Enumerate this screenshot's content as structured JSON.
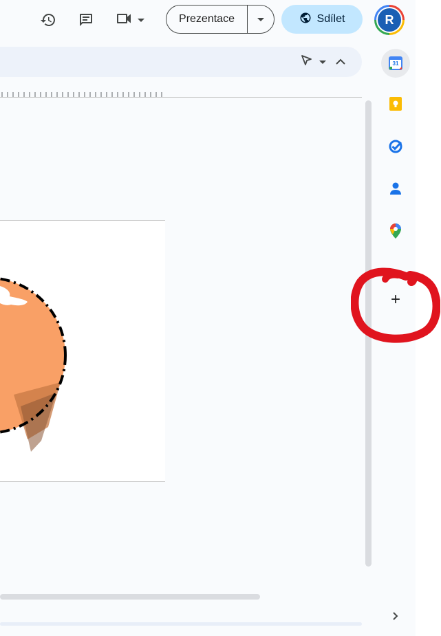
{
  "header": {
    "present_label": "Prezentace",
    "share_label": "Sdílet",
    "avatar_letter": "R",
    "icons": [
      "history-icon",
      "comment-icon",
      "meet-icon"
    ]
  },
  "side_panel": {
    "calendar_day": "31",
    "apps": [
      "calendar",
      "keep",
      "tasks",
      "contacts",
      "maps"
    ],
    "add_label": "+"
  },
  "colors": {
    "share_bg": "#c2e7ff",
    "avatar_bg": "#1a5fb4",
    "annotation_red": "#e0141e",
    "slide_shape": "#f9a066"
  }
}
